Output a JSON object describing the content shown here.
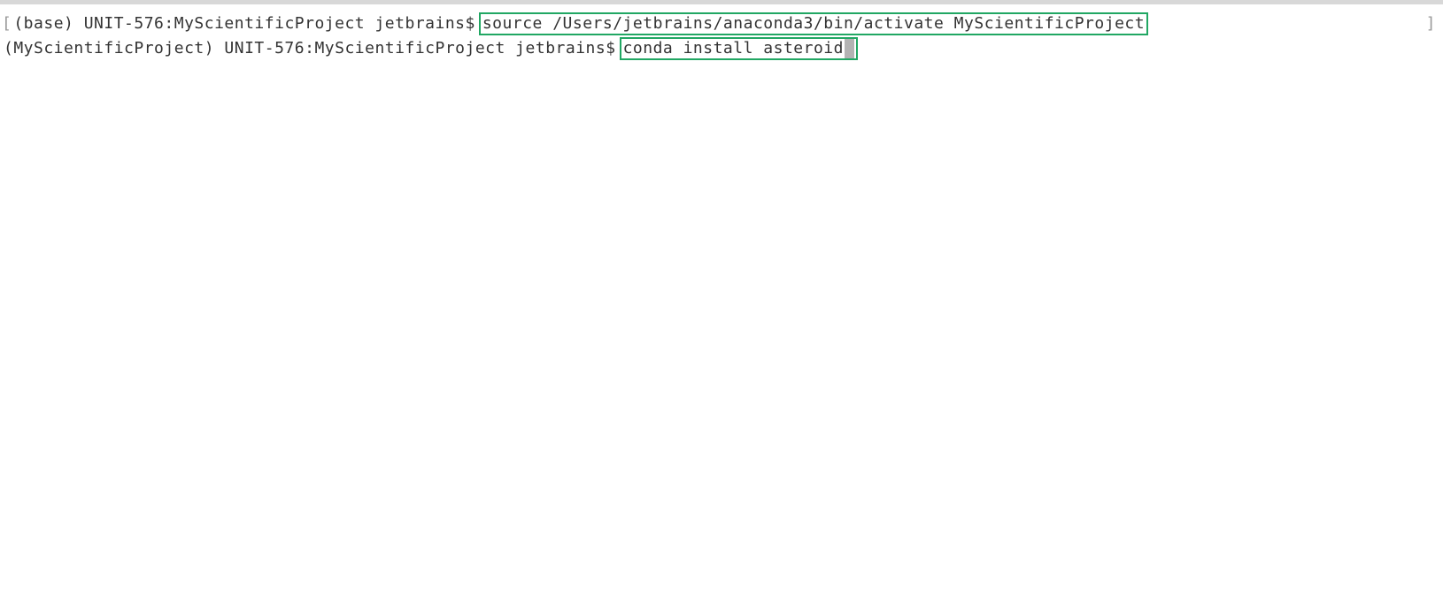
{
  "terminal": {
    "lines": [
      {
        "leading_bracket": "[",
        "prompt": "(base) UNIT-576:MyScientificProject jetbrains$",
        "command": "source /Users/jetbrains/anaconda3/bin/activate MyScientificProject",
        "has_cursor": false,
        "trailing_bracket": "]"
      },
      {
        "leading_bracket": "",
        "prompt": "(MyScientificProject) UNIT-576:MyScientificProject jetbrains$",
        "command": "conda install asteroid",
        "has_cursor": true,
        "trailing_bracket": ""
      }
    ]
  },
  "colors": {
    "highlight_border": "#21a763",
    "text": "#333333",
    "bracket": "#9a9a9a",
    "cursor": "#b3b3b3",
    "top_border": "#d8d8d8"
  }
}
